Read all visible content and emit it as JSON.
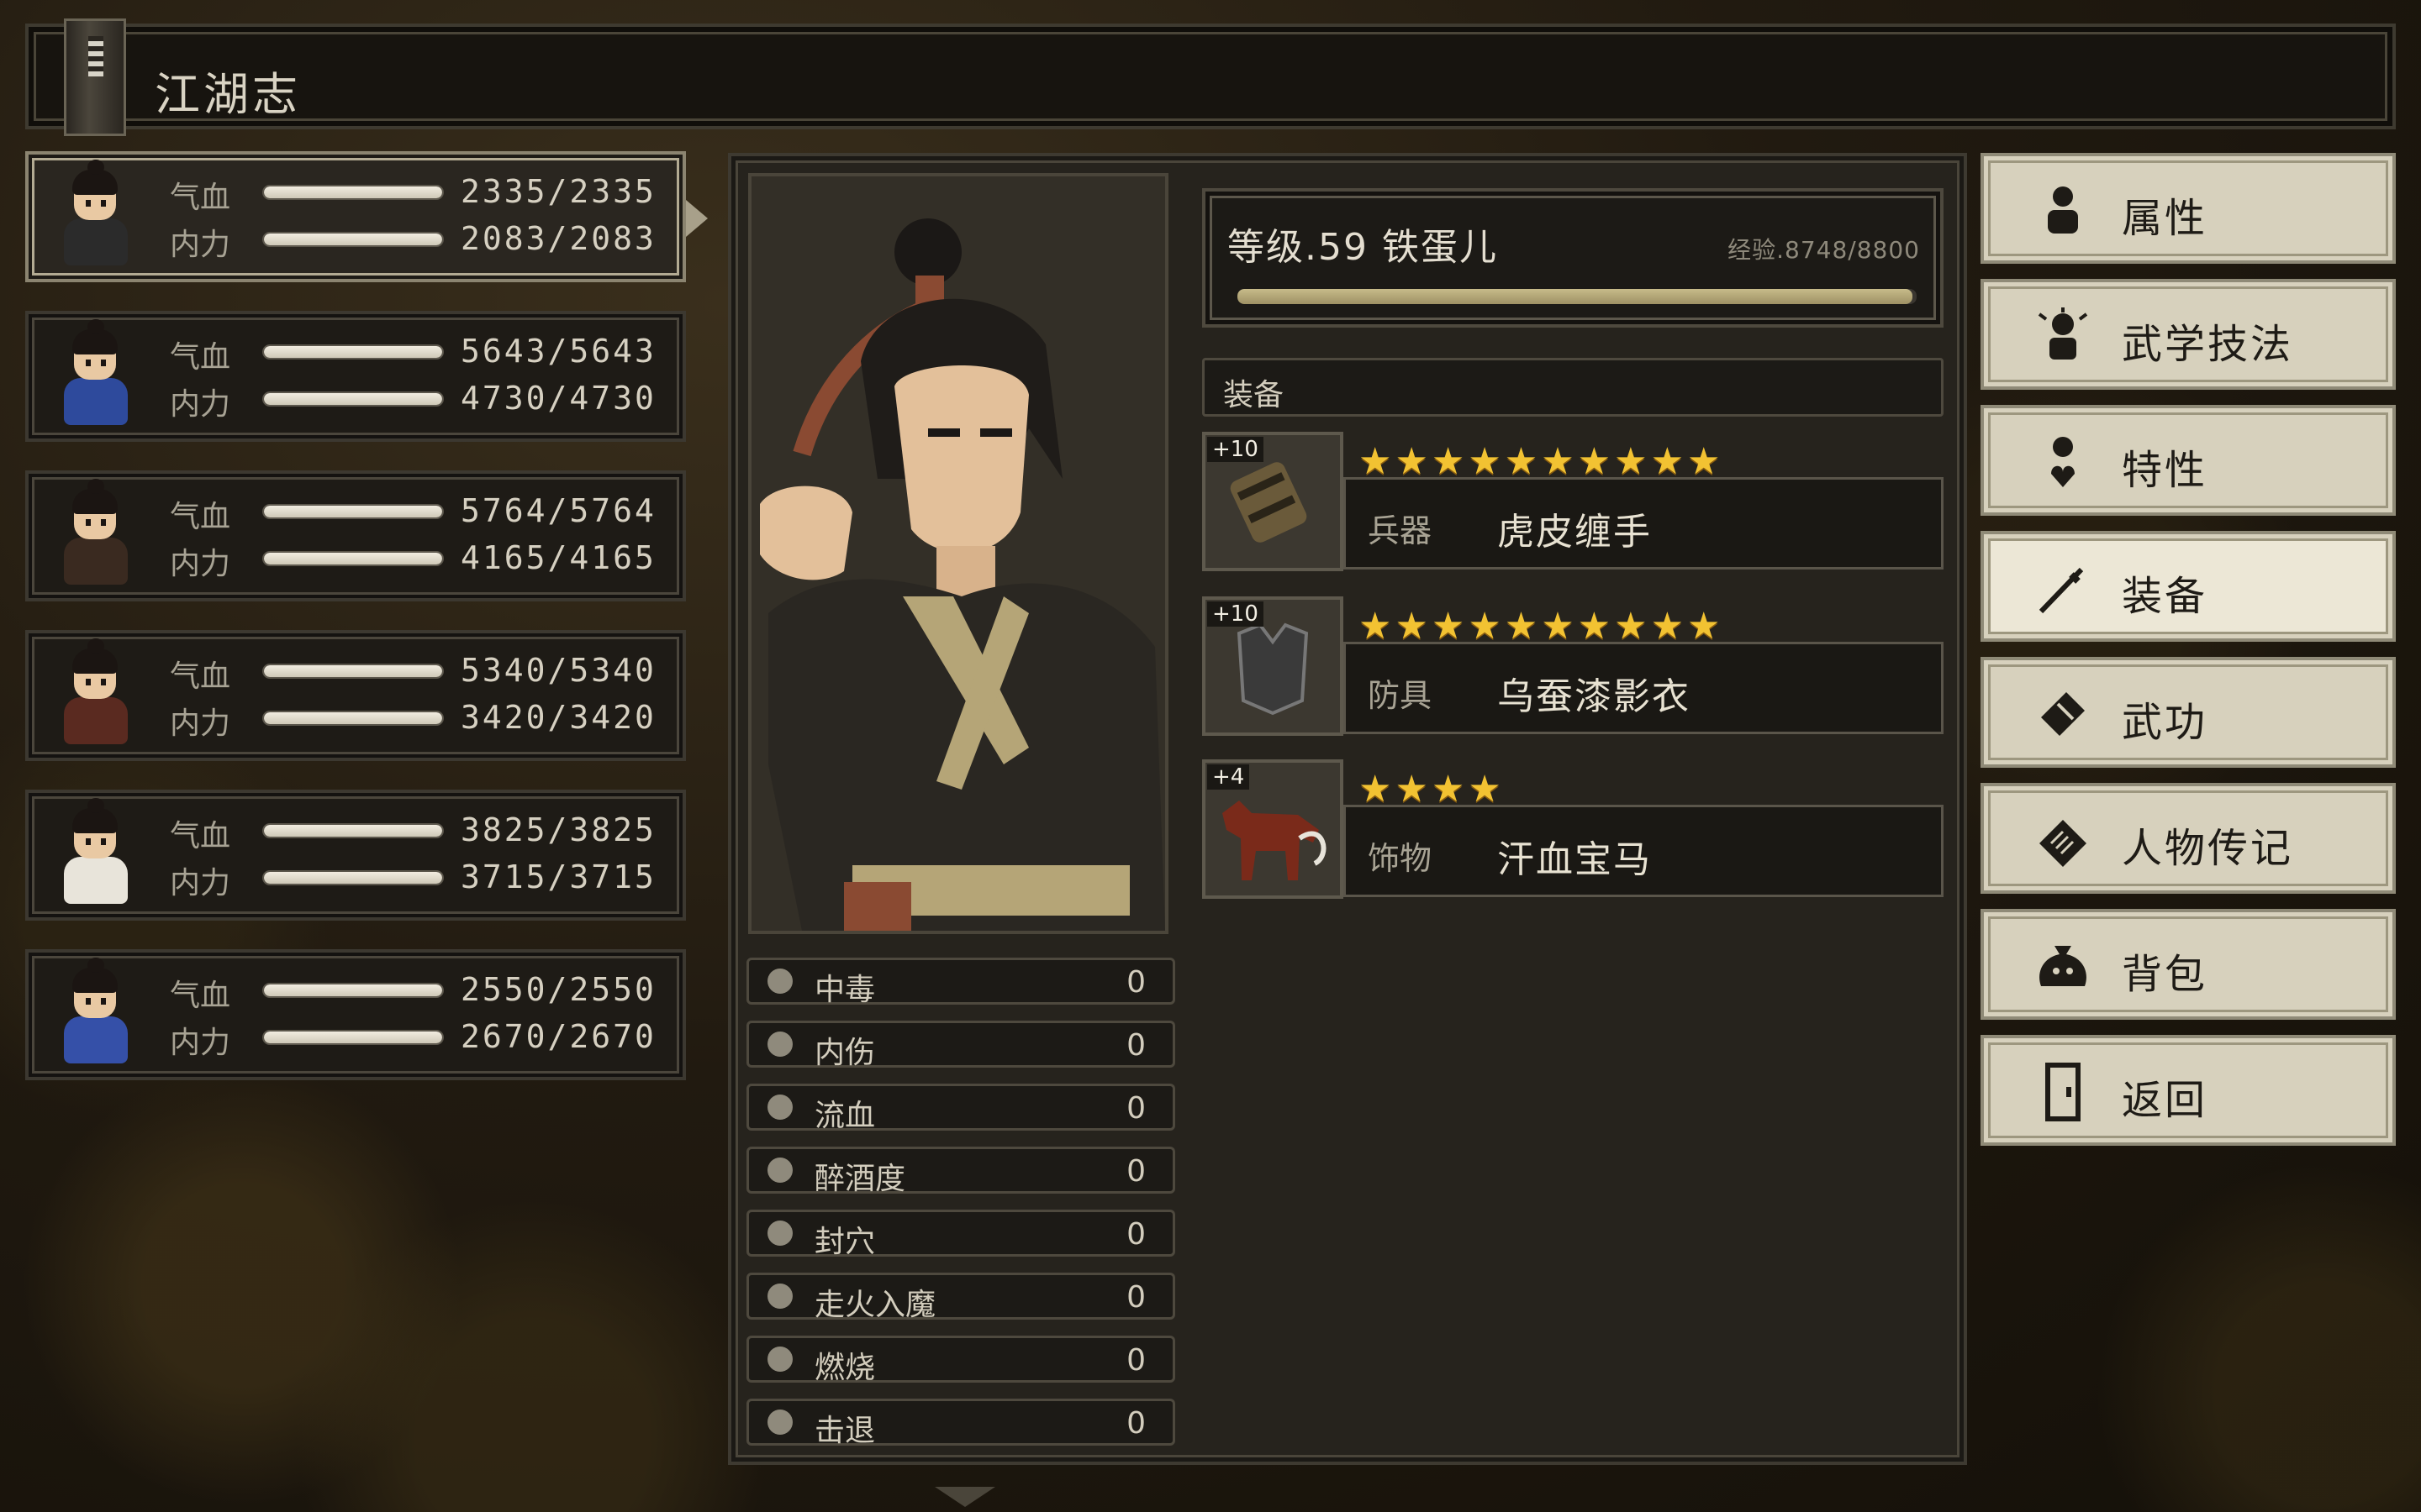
{
  "title": "江湖志",
  "characters": [
    {
      "hp_label": "气血",
      "hp": "2335/2335",
      "hp_frac": 1.0,
      "mp_label": "内力",
      "mp": "2083/2083",
      "mp_frac": 1.0,
      "robe": "#2b2b2b",
      "selected": true
    },
    {
      "hp_label": "气血",
      "hp": "5643/5643",
      "hp_frac": 1.0,
      "mp_label": "内力",
      "mp": "4730/4730",
      "mp_frac": 1.0,
      "robe": "#2e4a9c",
      "selected": false
    },
    {
      "hp_label": "气血",
      "hp": "5764/5764",
      "hp_frac": 1.0,
      "mp_label": "内力",
      "mp": "4165/4165",
      "mp_frac": 1.0,
      "robe": "#3a2a20",
      "selected": false
    },
    {
      "hp_label": "气血",
      "hp": "5340/5340",
      "hp_frac": 1.0,
      "mp_label": "内力",
      "mp": "3420/3420",
      "mp_frac": 1.0,
      "robe": "#5a2a20",
      "selected": false
    },
    {
      "hp_label": "气血",
      "hp": "3825/3825",
      "hp_frac": 1.0,
      "mp_label": "内力",
      "mp": "3715/3715",
      "mp_frac": 1.0,
      "robe": "#e8e4da",
      "selected": false
    },
    {
      "hp_label": "气血",
      "hp": "2550/2550",
      "hp_frac": 1.0,
      "mp_label": "内力",
      "mp": "2670/2670",
      "mp_frac": 1.0,
      "robe": "#3550a8",
      "selected": false
    }
  ],
  "level": {
    "text": "等级.59 铁蛋儿",
    "exp": "经验.8748/8800",
    "exp_frac": 0.994
  },
  "equip_header": "装备",
  "equipment": [
    {
      "plus": "+10",
      "stars": "★★★★★★★★★★",
      "type": "兵器",
      "name": "虎皮缠手",
      "icon": "bracer-icon"
    },
    {
      "plus": "+10",
      "stars": "★★★★★★★★★★",
      "type": "防具",
      "name": "乌蚕漆影衣",
      "icon": "armor-icon"
    },
    {
      "plus": "+4",
      "stars": "★★★★",
      "type": "饰物",
      "name": "汗血宝马",
      "icon": "horse-icon"
    }
  ],
  "statuses": [
    {
      "label": "中毒",
      "value": "0",
      "icon": "skull-icon"
    },
    {
      "label": "内伤",
      "value": "0",
      "icon": "broken-heart-icon"
    },
    {
      "label": "流血",
      "value": "0",
      "icon": "blood-icon"
    },
    {
      "label": "醉酒度",
      "value": "0",
      "icon": "drunk-icon"
    },
    {
      "label": "封穴",
      "value": "0",
      "icon": "acupoint-icon"
    },
    {
      "label": "走火入魔",
      "value": "0",
      "icon": "madness-icon"
    },
    {
      "label": "燃烧",
      "value": "0",
      "icon": "fire-icon"
    },
    {
      "label": "击退",
      "value": "0",
      "icon": "boot-icon"
    }
  ],
  "menu": [
    {
      "label": "属性",
      "icon": "character-icon",
      "active": false
    },
    {
      "label": "武学技法",
      "icon": "martial-arts-icon",
      "active": false
    },
    {
      "label": "特性",
      "icon": "trait-icon",
      "active": false
    },
    {
      "label": "装备",
      "icon": "sword-icon",
      "active": true
    },
    {
      "label": "武功",
      "icon": "manual-icon",
      "active": false
    },
    {
      "label": "人物传记",
      "icon": "biography-icon",
      "active": false
    },
    {
      "label": "背包",
      "icon": "bag-icon",
      "active": false
    },
    {
      "label": "返回",
      "icon": "door-icon",
      "active": false
    }
  ],
  "colors": {
    "accent_gold": "#f2c232",
    "panel": "#26231d",
    "menu_bg": "#d7d1bd"
  }
}
